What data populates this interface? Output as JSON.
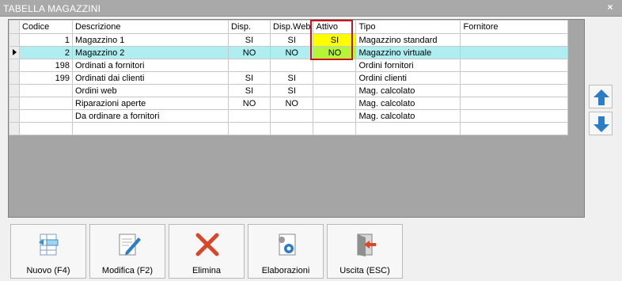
{
  "window": {
    "title": "TABELLA MAGAZZINI",
    "close_glyph": "×"
  },
  "grid": {
    "columns": [
      "Codice",
      "Descrizione",
      "Disp.",
      "Disp.Web",
      "Attivo",
      "Tipo",
      "Fornitore"
    ],
    "rows": [
      {
        "codice": "1",
        "descrizione": "Magazzino 1",
        "disp": "SI",
        "disp_web": "SI",
        "attivo": "SI",
        "tipo": "Magazzino standard",
        "fornitore": ""
      },
      {
        "codice": "2",
        "descrizione": "Magazzino 2",
        "disp": "NO",
        "disp_web": "NO",
        "attivo": "NO",
        "tipo": "Magazzino virtuale",
        "fornitore": ""
      },
      {
        "codice": "198",
        "descrizione": "Ordinati a fornitori",
        "disp": "",
        "disp_web": "",
        "attivo": "",
        "tipo": "Ordini fornitori",
        "fornitore": ""
      },
      {
        "codice": "199",
        "descrizione": "Ordinati dai clienti",
        "disp": "SI",
        "disp_web": "SI",
        "attivo": "",
        "tipo": "Ordini clienti",
        "fornitore": ""
      },
      {
        "codice": "",
        "descrizione": "Ordini web",
        "disp": "SI",
        "disp_web": "SI",
        "attivo": "",
        "tipo": "Mag. calcolato",
        "fornitore": ""
      },
      {
        "codice": "",
        "descrizione": "Riparazioni aperte",
        "disp": "NO",
        "disp_web": "NO",
        "attivo": "",
        "tipo": "Mag. calcolato",
        "fornitore": ""
      },
      {
        "codice": "",
        "descrizione": "Da ordinare a fornitori",
        "disp": "",
        "disp_web": "",
        "attivo": "",
        "tipo": "Mag. calcolato",
        "fornitore": ""
      },
      {
        "codice": "",
        "descrizione": "",
        "disp": "",
        "disp_web": "",
        "attivo": "",
        "tipo": "",
        "fornitore": ""
      }
    ],
    "selected_row": 1
  },
  "side_buttons": {
    "up_icon": "arrow-up-icon",
    "down_icon": "arrow-down-icon"
  },
  "toolbar": {
    "nuovo": "Nuovo (F4)",
    "modifica": "Modifica (F2)",
    "elimina": "Elimina",
    "elaborazioni": "Elaborazioni",
    "uscita": "Uscita (ESC)"
  },
  "colors": {
    "titlebar": "#a9a9a9",
    "selected_row": "#aeeef1",
    "attivo_si": "#ffff00",
    "attivo_no": "#b6f43a",
    "highlight_border": "#c8141e",
    "arrow_blue": "#2a7ec8",
    "delete_red": "#d9472b"
  }
}
